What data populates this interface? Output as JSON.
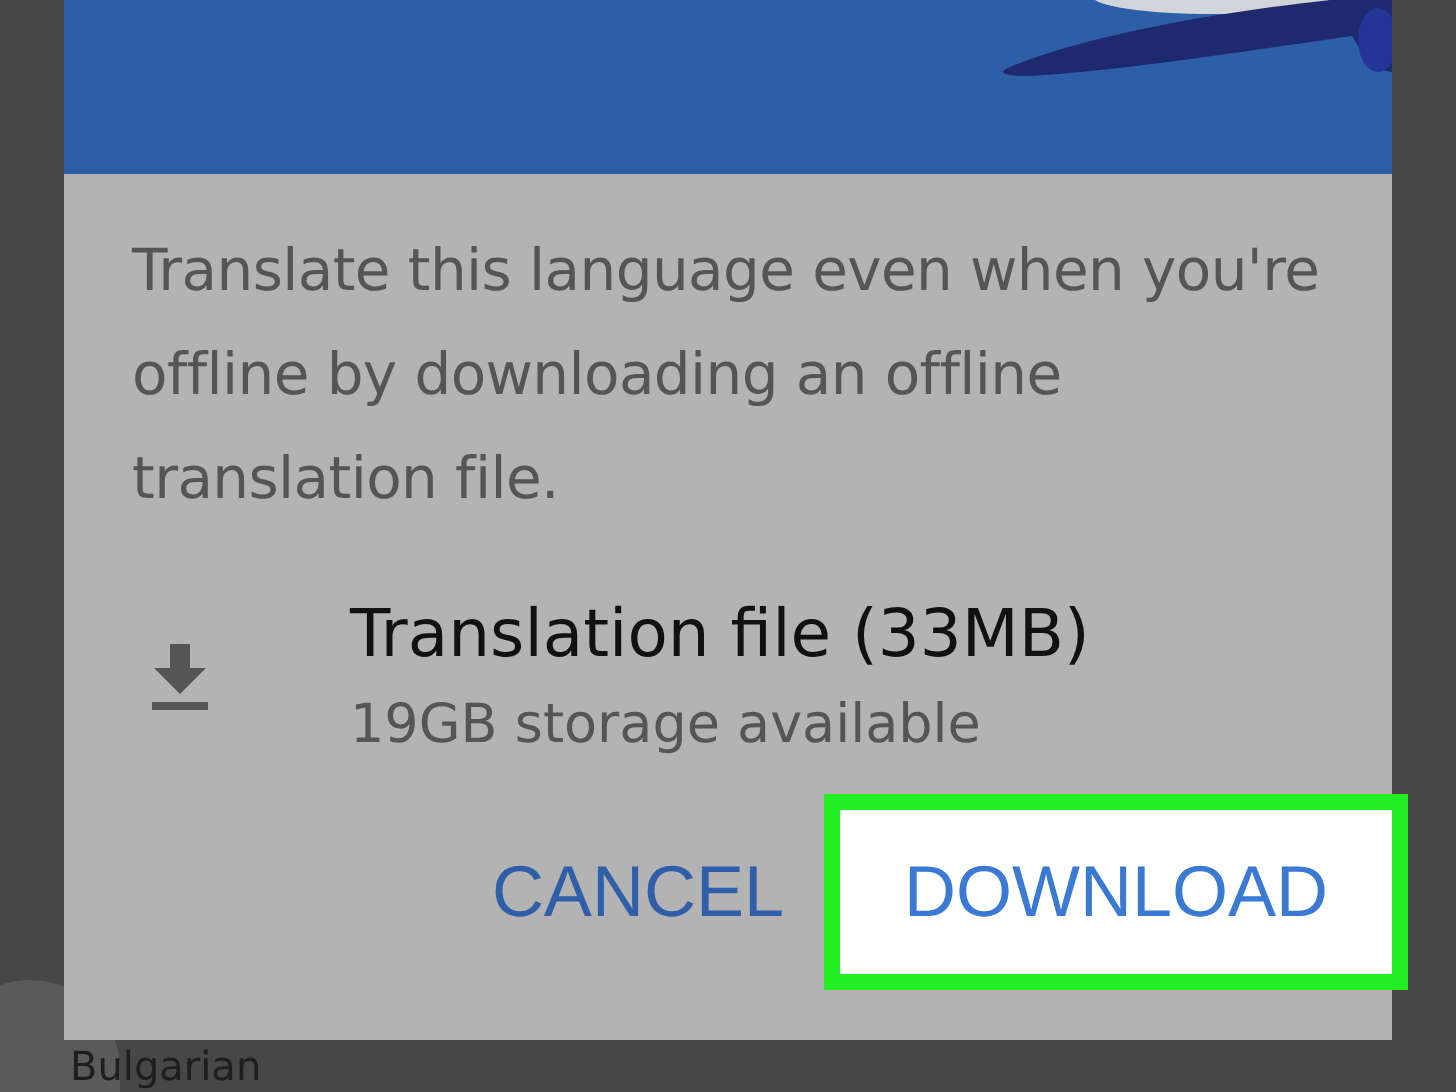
{
  "background_list": {
    "items": [
      {
        "label": "Bulgarian"
      }
    ]
  },
  "dialog": {
    "description": "Translate this language even when you're offline by downloading an offline translation file.",
    "file": {
      "title": "Translation file (33MB)",
      "subtitle": "19GB storage available"
    },
    "buttons": [
      {
        "label": "CANCEL",
        "highlighted": false
      },
      {
        "label": "DOWNLOAD",
        "highlighted": true
      }
    ]
  }
}
